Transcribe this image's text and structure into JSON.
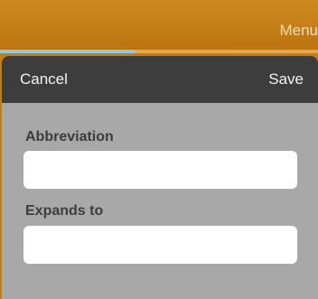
{
  "top_bar": {
    "menu_label": "Menu"
  },
  "sheet": {
    "cancel_label": "Cancel",
    "save_label": "Save",
    "abbreviation": {
      "label": "Abbreviation",
      "value": ""
    },
    "expands_to": {
      "label": "Expands to",
      "value": ""
    }
  },
  "colors": {
    "top_bar": "#c47c15",
    "tab_active": "#8ec8e2",
    "tab_inactive": "#e5a84e",
    "sheet_header": "#3d3d3d",
    "sheet_body": "#a8a8a8",
    "field_background": "#ffffff"
  }
}
